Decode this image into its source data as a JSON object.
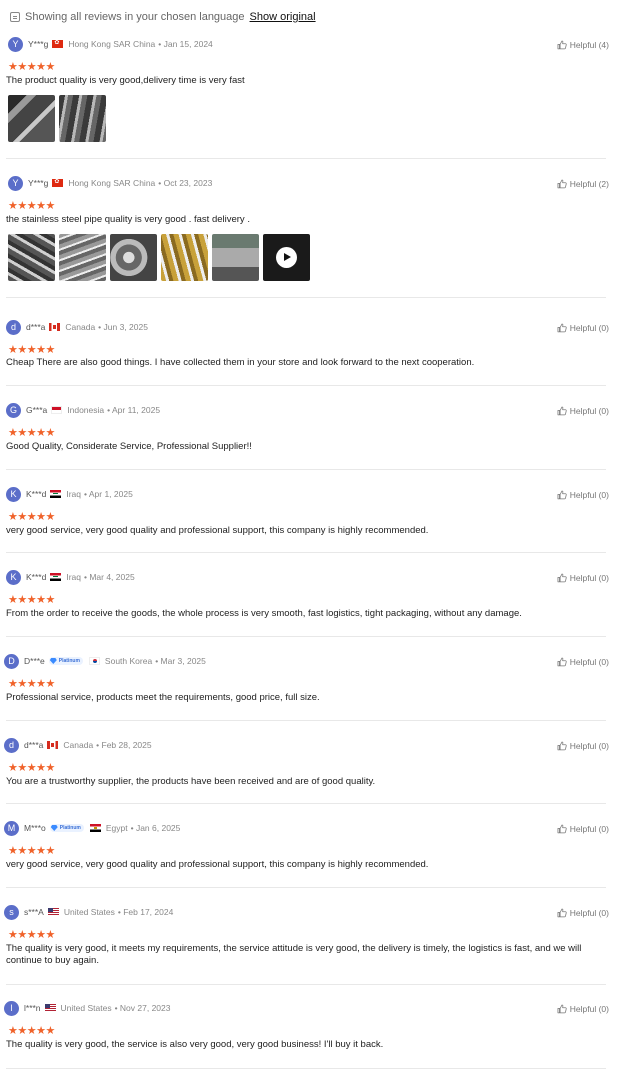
{
  "notice": {
    "text": "Showing all reviews in your chosen language",
    "link": "Show original"
  },
  "stars_text": "★★★★★",
  "helpful_icon": "thumbs-up-icon",
  "reviews": [
    {
      "initial": "Y",
      "name": "Y***g",
      "flag": "hk",
      "country": "Hong Kong SAR China",
      "date": "• Jan 15, 2024",
      "helpful": "Helpful (4)",
      "text": "The product quality is very good,delivery time is very fast",
      "media": [
        "t-a",
        "t-b"
      ]
    },
    {
      "initial": "Y",
      "name": "Y***g",
      "flag": "hk",
      "country": "Hong Kong SAR China",
      "date": "• Oct 23, 2023",
      "helpful": "Helpful (2)",
      "text": "the stainless steel pipe quality is very good . fast delivery .",
      "media": [
        "t-c",
        "t-d",
        "t-e",
        "t-f",
        "t-g",
        "t-h-video"
      ]
    },
    {
      "initial": "d",
      "name": "d***a",
      "flag": "ca",
      "country": "Canada",
      "date": "• Jun 3, 2025",
      "helpful": "Helpful (0)",
      "text": "Cheap There are also good things. I have collected them in your store and look forward to the next cooperation."
    },
    {
      "initial": "G",
      "name": "G***a",
      "flag": "id",
      "country": "Indonesia",
      "date": "• Apr 11, 2025",
      "helpful": "Helpful (0)",
      "text": "Good Quality, Considerate Service, Professional Supplier!!"
    },
    {
      "initial": "K",
      "name": "K***d",
      "flag": "iq",
      "country": "Iraq",
      "date": "• Apr 1, 2025",
      "helpful": "Helpful (0)",
      "text": "very good service, very good quality and professional support, this company is highly recommended."
    },
    {
      "initial": "K",
      "name": "K***d",
      "flag": "iq",
      "country": "Iraq",
      "date": "• Mar 4, 2025",
      "helpful": "Helpful (0)",
      "text": "From the order to receive the goods, the whole process is very smooth, fast logistics, tight packaging, without any damage."
    },
    {
      "initial": "D",
      "name": "D***e",
      "badge": "Platinum",
      "flag": "kr",
      "country": "South Korea",
      "date": "• Mar 3, 2025",
      "helpful": "Helpful (0)",
      "text": "Professional service, products meet the requirements, good price, full size."
    },
    {
      "initial": "d",
      "name": "d***a",
      "flag": "ca",
      "country": "Canada",
      "date": "• Feb 28, 2025",
      "helpful": "Helpful (0)",
      "text": "You are a trustworthy supplier, the products have been received and are of good quality."
    },
    {
      "initial": "M",
      "name": "M***o",
      "badge": "Platinum",
      "flag": "eg",
      "country": "Egypt",
      "date": "• Jan 6, 2025",
      "helpful": "Helpful (0)",
      "text": "very good service, very good quality and professional support, this company is highly recommended."
    },
    {
      "initial": "s",
      "name": "s***A",
      "flag": "us",
      "country": "United States",
      "date": "• Feb 17, 2024",
      "helpful": "Helpful (0)",
      "text": "The quality is very good, it meets my requirements, the service attitude is very good, the delivery is timely, the logistics is fast, and we will continue to buy again."
    },
    {
      "initial": "l",
      "name": "l***n",
      "flag": "us",
      "country": "United States",
      "date": "• Nov 27, 2023",
      "helpful": "Helpful (0)",
      "text": "The quality is very good, the service is also very good, very good business! I'll buy it back."
    }
  ]
}
